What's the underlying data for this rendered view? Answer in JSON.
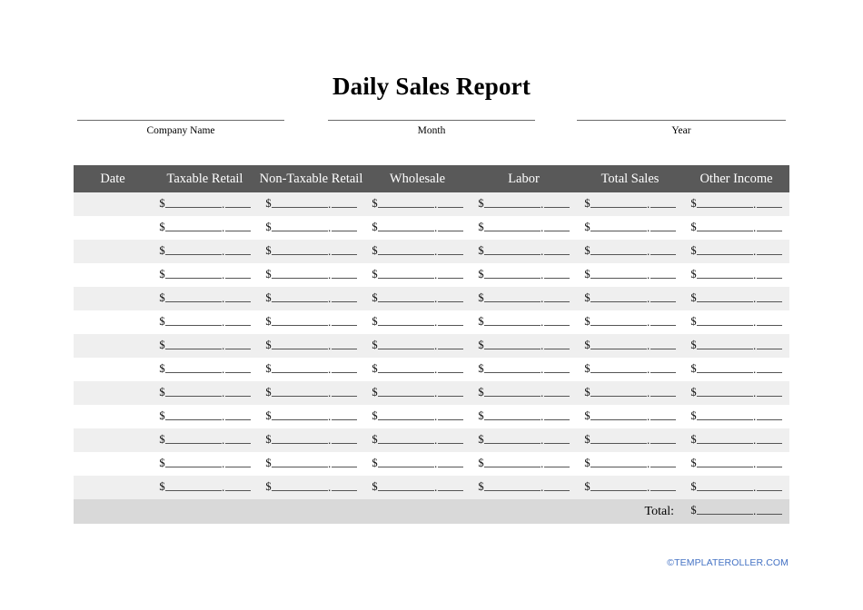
{
  "document": {
    "title": "Daily Sales Report"
  },
  "meta": {
    "fields": [
      {
        "label": "Company Name",
        "value": ""
      },
      {
        "label": "Month",
        "value": ""
      },
      {
        "label": "Year",
        "value": ""
      }
    ]
  },
  "table": {
    "columns": [
      "Date",
      "Taxable Retail",
      "Non-Taxable Retail",
      "Wholesale",
      "Labor",
      "Total Sales",
      "Other Income"
    ],
    "money_blank": {
      "currency_symbol": "$",
      "decimal_separator": ".",
      "dollars_value": "",
      "cents_value": ""
    },
    "row_count": 13,
    "rows": [
      {
        "date": "",
        "taxable_retail": "",
        "non_taxable_retail": "",
        "wholesale": "",
        "labor": "",
        "total_sales": "",
        "other_income": ""
      },
      {
        "date": "",
        "taxable_retail": "",
        "non_taxable_retail": "",
        "wholesale": "",
        "labor": "",
        "total_sales": "",
        "other_income": ""
      },
      {
        "date": "",
        "taxable_retail": "",
        "non_taxable_retail": "",
        "wholesale": "",
        "labor": "",
        "total_sales": "",
        "other_income": ""
      },
      {
        "date": "",
        "taxable_retail": "",
        "non_taxable_retail": "",
        "wholesale": "",
        "labor": "",
        "total_sales": "",
        "other_income": ""
      },
      {
        "date": "",
        "taxable_retail": "",
        "non_taxable_retail": "",
        "wholesale": "",
        "labor": "",
        "total_sales": "",
        "other_income": ""
      },
      {
        "date": "",
        "taxable_retail": "",
        "non_taxable_retail": "",
        "wholesale": "",
        "labor": "",
        "total_sales": "",
        "other_income": ""
      },
      {
        "date": "",
        "taxable_retail": "",
        "non_taxable_retail": "",
        "wholesale": "",
        "labor": "",
        "total_sales": "",
        "other_income": ""
      },
      {
        "date": "",
        "taxable_retail": "",
        "non_taxable_retail": "",
        "wholesale": "",
        "labor": "",
        "total_sales": "",
        "other_income": ""
      },
      {
        "date": "",
        "taxable_retail": "",
        "non_taxable_retail": "",
        "wholesale": "",
        "labor": "",
        "total_sales": "",
        "other_income": ""
      },
      {
        "date": "",
        "taxable_retail": "",
        "non_taxable_retail": "",
        "wholesale": "",
        "labor": "",
        "total_sales": "",
        "other_income": ""
      },
      {
        "date": "",
        "taxable_retail": "",
        "non_taxable_retail": "",
        "wholesale": "",
        "labor": "",
        "total_sales": "",
        "other_income": ""
      },
      {
        "date": "",
        "taxable_retail": "",
        "non_taxable_retail": "",
        "wholesale": "",
        "labor": "",
        "total_sales": "",
        "other_income": ""
      },
      {
        "date": "",
        "taxable_retail": "",
        "non_taxable_retail": "",
        "wholesale": "",
        "labor": "",
        "total_sales": "",
        "other_income": ""
      }
    ],
    "total": {
      "label": "Total:",
      "value": ""
    }
  },
  "footer": {
    "copyright_symbol": "©",
    "text": "TEMPLATEROLLER.COM"
  },
  "colors": {
    "header_background": "#595959",
    "header_text": "#ffffff",
    "row_stripe": "#efefef",
    "row_base": "#ffffff",
    "total_background": "#d9d9d9",
    "footer_link": "#4472c4",
    "rule": "#6b6b6b"
  }
}
